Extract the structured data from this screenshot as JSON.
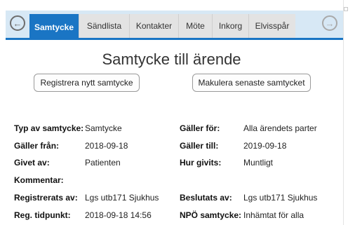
{
  "tabs": [
    {
      "label": "Samtycke"
    },
    {
      "label": "Sändlista"
    },
    {
      "label": "Kontakter"
    },
    {
      "label": "Möte"
    },
    {
      "label": "Inkorg"
    },
    {
      "label": "Elvisspår"
    }
  ],
  "active_tab": "Samtycke",
  "nav": {
    "prev_icon": "arrow-left-circle-icon",
    "next_icon": "arrow-right-circle-icon"
  },
  "page": {
    "title": "Samtycke till ärende"
  },
  "actions": {
    "register_label": "Registrera nytt samtycke",
    "cancel_label": "Makulera senaste samtycket"
  },
  "details": {
    "type_label": "Typ av samtycke:",
    "type_value": "Samtycke",
    "applies_to_label": "Gäller för:",
    "applies_to_value": "Alla ärendets parter",
    "valid_from_label": "Gäller från:",
    "valid_from_value": "2018-09-18",
    "valid_to_label": "Gäller till:",
    "valid_to_value": "2019-09-18",
    "given_by_label": "Givet av:",
    "given_by_value": "Patienten",
    "how_given_label": "Hur givits:",
    "how_given_value": "Muntligt",
    "comment_label": "Kommentar:",
    "registered_by_label": "Registrerats av:",
    "registered_by_value": "Lgs utb171 Sjukhus",
    "decided_by_label": "Beslutats av:",
    "decided_by_value": "Lgs utb171 Sjukhus",
    "reg_time_label": "Reg. tidpunkt:",
    "reg_time_value": "2018-09-18 14:56",
    "npo_label": "NPÖ samtycke:",
    "npo_value": "Inhämtat för alla"
  },
  "colors": {
    "accent": "#1a75c4",
    "tabbar_bg": "#d7e8f5",
    "tab_bg": "#e3e3e3"
  }
}
